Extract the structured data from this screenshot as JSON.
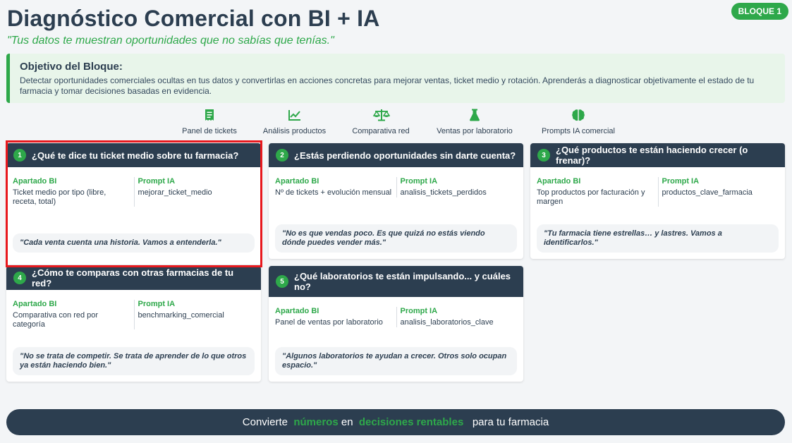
{
  "header": {
    "title": "Diagnóstico Comercial con BI + IA",
    "subtitle": "\"Tus datos te muestran oportunidades que no sabías que tenías.\"",
    "badge": "BLOQUE 1"
  },
  "objective": {
    "heading": "Objetivo del Bloque:",
    "text": "Detectar oportunidades comerciales ocultas en tus datos y convertirlas en acciones concretas para mejorar ventas, ticket medio y rotación. Aprenderás a diagnosticar objetivamente el estado de tu farmacia y tomar decisiones basadas en evidencia."
  },
  "nav": [
    {
      "label": "Panel de tickets",
      "icon": "receipt-icon"
    },
    {
      "label": "Análisis productos",
      "icon": "line-chart-icon"
    },
    {
      "label": "Comparativa red",
      "icon": "balance-scale-icon"
    },
    {
      "label": "Ventas por laboratorio",
      "icon": "flask-icon"
    },
    {
      "label": "Prompts IA comercial",
      "icon": "brain-icon"
    }
  ],
  "cards": [
    {
      "num": "1",
      "title": "¿Qué te dice tu ticket medio sobre tu farmacia?",
      "bi_label": "Apartado BI",
      "bi": "Ticket medio por tipo (libre, receta, total)",
      "prompt_label": "Prompt IA",
      "prompt": "mejorar_ticket_medio",
      "quote": "\"Cada venta cuenta una historia. Vamos a entenderla.\""
    },
    {
      "num": "2",
      "title": "¿Estás perdiendo oportunidades sin darte cuenta?",
      "bi_label": "Apartado BI",
      "bi": "Nº de tickets + evolución mensual",
      "prompt_label": "Prompt IA",
      "prompt": "analisis_tickets_perdidos",
      "quote": "\"No es que vendas poco. Es que quizá no estás viendo dónde puedes vender más.\""
    },
    {
      "num": "3",
      "title": "¿Qué productos te están haciendo crecer (o frenar)?",
      "bi_label": "Apartado BI",
      "bi": "Top productos por facturación y margen",
      "prompt_label": "Prompt IA",
      "prompt": "productos_clave_farmacia",
      "quote": "\"Tu farmacia tiene estrellas… y lastres. Vamos a identificarlos.\""
    },
    {
      "num": "4",
      "title": "¿Cómo te comparas con otras farmacias de tu red?",
      "bi_label": "Apartado BI",
      "bi": "Comparativa con red por categoría",
      "prompt_label": "Prompt IA",
      "prompt": "benchmarking_comercial",
      "quote": "\"No se trata de competir. Se trata de aprender de lo que otros ya están haciendo bien.\""
    },
    {
      "num": "5",
      "title": "¿Qué laboratorios te están impulsando... y cuáles no?",
      "bi_label": "Apartado BI",
      "bi": "Panel de ventas por laboratorio",
      "prompt_label": "Prompt IA",
      "prompt": "analisis_laboratorios_clave",
      "quote": "\"Algunos laboratorios te ayudan a crecer. Otros solo ocupan espacio.\""
    }
  ],
  "footer": {
    "part1": "Convierte",
    "part2": "números",
    "part3": "en",
    "part4": "decisiones rentables",
    "part5": "para tu farmacia"
  },
  "colors": {
    "accent": "#2ea84a",
    "dark": "#2c3e50",
    "highlight": "#e8191e"
  }
}
